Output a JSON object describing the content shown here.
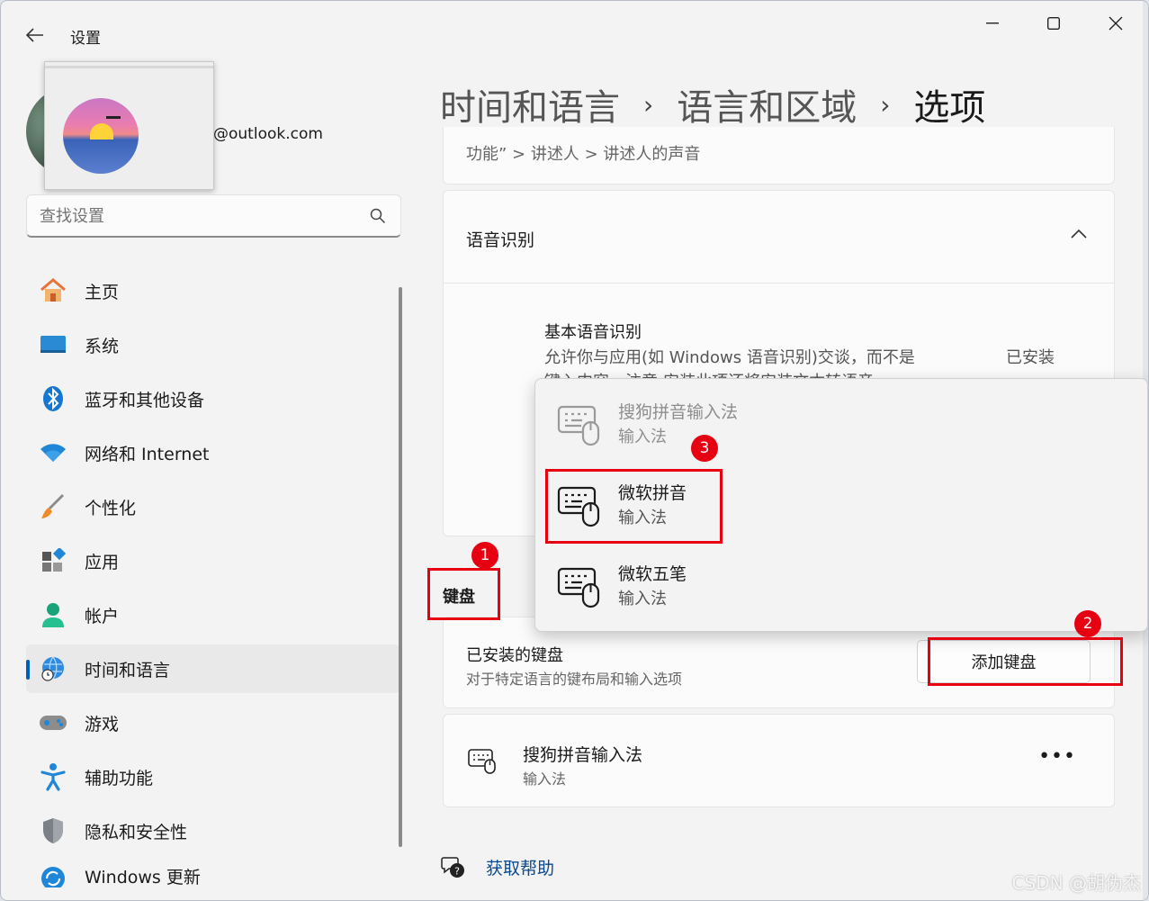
{
  "window": {
    "title": "设置",
    "controls": {
      "minimize": "minimize-icon",
      "maximize": "maximize-icon",
      "close": "close-icon"
    }
  },
  "profile": {
    "email": "@outlook.com"
  },
  "search": {
    "placeholder": "查找设置"
  },
  "sidebar": {
    "items": [
      {
        "label": "主页",
        "icon": "home-icon"
      },
      {
        "label": "系统",
        "icon": "monitor-icon"
      },
      {
        "label": "蓝牙和其他设备",
        "icon": "bluetooth-icon"
      },
      {
        "label": "网络和 Internet",
        "icon": "wifi-icon"
      },
      {
        "label": "个性化",
        "icon": "brush-icon"
      },
      {
        "label": "应用",
        "icon": "apps-icon"
      },
      {
        "label": "帐户",
        "icon": "person-icon"
      },
      {
        "label": "时间和语言",
        "icon": "globe-clock-icon",
        "active": true
      },
      {
        "label": "游戏",
        "icon": "gamepad-icon"
      },
      {
        "label": "辅助功能",
        "icon": "accessibility-icon"
      },
      {
        "label": "隐私和安全性",
        "icon": "shield-icon"
      },
      {
        "label": "Windows 更新",
        "icon": "update-icon"
      }
    ]
  },
  "breadcrumb": {
    "level1": "时间和语言",
    "level2": "语言和区域",
    "current": "选项",
    "separator": "›"
  },
  "content": {
    "top_card_text": "功能” > 讲述人 > 讲述人的声音",
    "speech_section": {
      "title": "语音识别",
      "item_title": "基本语音识别",
      "item_desc_line1": "允许你与应用(如 Windows 语音识别)交谈，而不是",
      "item_desc_line2": "键入内容。注意:安装此项还将安装文本转语音",
      "status": "已安装"
    },
    "keyboard_section": {
      "label": "键盘",
      "installed_title": "已安装的键盘",
      "installed_desc": "对于特定语言的键布局和输入选项",
      "add_button": "添加键盘"
    },
    "installed_ime": {
      "name": "搜狗拼音输入法",
      "type": "输入法",
      "more": "•••"
    },
    "help_link": "获取帮助"
  },
  "flyout": {
    "items": [
      {
        "name": "搜狗拼音输入法",
        "type": "输入法",
        "disabled": true
      },
      {
        "name": "微软拼音",
        "type": "输入法",
        "disabled": false
      },
      {
        "name": "微软五笔",
        "type": "输入法",
        "disabled": false
      }
    ]
  },
  "annotations": {
    "badge1": "1",
    "badge2": "2",
    "badge3": "3",
    "accent": "#e60012"
  },
  "watermark": "CSDN @胡伪杰",
  "colors": {
    "accent": "#005fb8",
    "annotation_red": "#e60012"
  }
}
